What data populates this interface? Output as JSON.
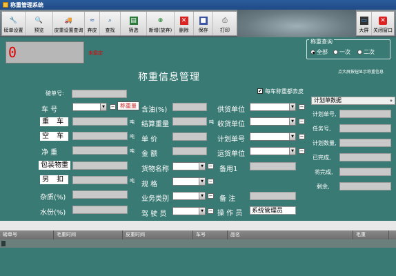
{
  "window": {
    "title": "称重管理系统"
  },
  "toolbar": {
    "buttons": [
      {
        "label": "磅单设置",
        "icon": "wrench"
      },
      {
        "label": "预览",
        "icon": "magnifier"
      },
      {
        "label": "皮重设置查询",
        "icon": "truck"
      },
      {
        "label": "弃皮",
        "icon": "wave"
      },
      {
        "label": "查找",
        "icon": "search"
      },
      {
        "label": "筛选",
        "icon": "filter"
      },
      {
        "label": "新增(放弃)",
        "icon": "plus"
      },
      {
        "label": "删除",
        "icon": "delete"
      },
      {
        "label": "保存",
        "icon": "save"
      },
      {
        "label": "打印",
        "icon": "printer"
      }
    ],
    "right_buttons": [
      {
        "label": "大屏",
        "icon": "screen"
      },
      {
        "label": "关闭窗口",
        "icon": "close"
      }
    ]
  },
  "scale": {
    "weight": "0",
    "status": "未稳定"
  },
  "query": {
    "legend": "称重查询",
    "options": [
      "全部",
      "一次",
      "二次"
    ],
    "selected": "全部"
  },
  "hint": "点大屏按钮显示称重信息",
  "page_title": "称重信息管理",
  "ticket": {
    "label": "磅单号:",
    "value": ""
  },
  "checkbox_label": "每车称重都去皮",
  "checkbox_checked": true,
  "weigh_btn": "称重量",
  "form": {
    "car_no": "车  号",
    "gross": "重  车",
    "tare": "空  车",
    "net": "净  重",
    "package": "包装物重",
    "deduct": "另  扣",
    "impurity": "杂质(%)",
    "moisture": "水份(%)",
    "oil": "含油(%)",
    "settle": "结算重量",
    "price": "单    价",
    "amount": "金    额",
    "goods": "货物名称",
    "spec": "规    格",
    "biz_type": "业务类别",
    "driver": "驾  驶  员",
    "supplier": "供货单位",
    "receiver": "收货单位",
    "plan_no": "计划单号",
    "transport": "运货单位",
    "remark1": "备用1",
    "remark": "备    注",
    "operator": "操  作  员",
    "operator_value": "系统管理员",
    "unit_kg": "吨"
  },
  "plan": {
    "header": "计划单数据",
    "labels": [
      "计划单号,",
      "任务号,",
      "计划数量,",
      "已完成,",
      "将完成,",
      "剩余,"
    ]
  },
  "table": {
    "columns": [
      "磅单号",
      "毛重时间",
      "皮重时间",
      "车号",
      "品名",
      "毛重"
    ]
  }
}
